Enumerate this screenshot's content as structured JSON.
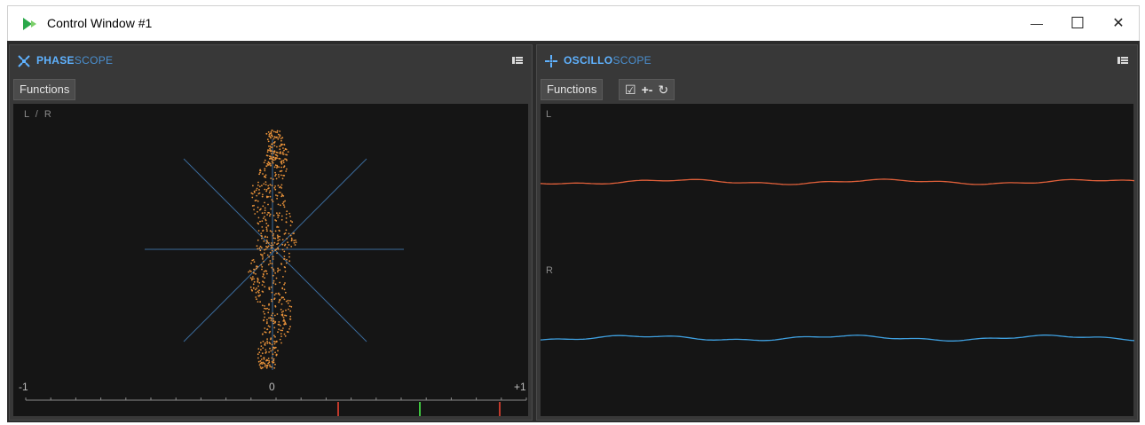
{
  "window": {
    "title": "Control Window #1",
    "min_glyph": "—",
    "max_glyph": "☐",
    "close_glyph": "✕"
  },
  "phasescope": {
    "title_hl": "PHASE",
    "title_lo": "SCOPE",
    "functions_label": "Functions",
    "lr_label": "L / R",
    "scale": {
      "left": "-1",
      "center": "0",
      "right": "+1"
    }
  },
  "oscilloscope": {
    "title_hl": "OSCILLO",
    "title_lo": "SCOPE",
    "functions_label": "Functions",
    "tools": {
      "check": "☑",
      "zoom": "+-",
      "reset": "↻"
    },
    "left_label": "L",
    "right_label": "R"
  },
  "colors": {
    "accent": "#5fb2ff",
    "trace_left": "#e0603a",
    "trace_right": "#3fa0e0",
    "dots": "#e8923a",
    "axes": "#3a6a9a",
    "marker_red": "#c0392b",
    "marker_green": "#3ec43e"
  }
}
